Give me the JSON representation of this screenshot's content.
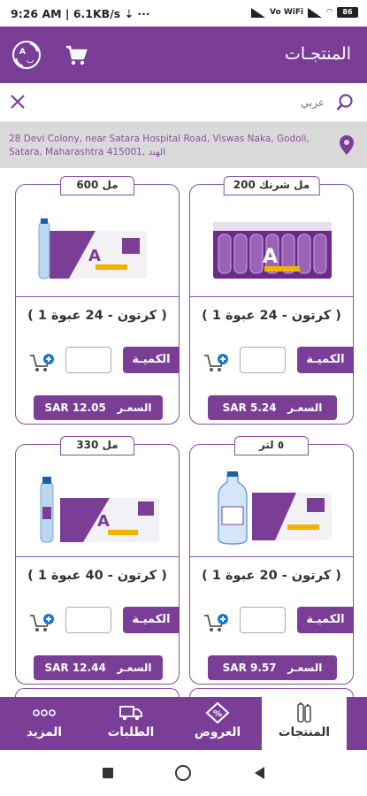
{
  "status_bar": {
    "time": "9:26 AM",
    "speed": "6.1KB/s",
    "network": "Vo WiFi",
    "battery": "86"
  },
  "app_bar": {
    "title": "المنتجـات",
    "icons": [
      "language-switch-icon",
      "cart-icon"
    ]
  },
  "search": {
    "placeholder": "عربي",
    "icons": [
      "close-icon",
      "search-icon"
    ]
  },
  "location": {
    "address": "28 Devi Colony, near Satara Hospital Road, Viswas Naka, Godoli, Satara, Maharashtra 415001, الهند",
    "icon": "location-pin-icon"
  },
  "colors": {
    "brand": "#7a3e96",
    "brand_border": "#8a4fa3"
  },
  "products": [
    {
      "size": "200 مل شرنك",
      "pack": "( 1 كرتون - 24 عبوة )",
      "qty_label": "الكميـة",
      "price_label": "السعـر",
      "price": "SAR 5.24"
    },
    {
      "size": "600 مل",
      "pack": "( 1 كرتون - 24 عبوة )",
      "qty_label": "الكميـة",
      "price_label": "السعـر",
      "price": "SAR 12.05"
    },
    {
      "size": "٥ لتر",
      "pack": "( 1 كرتون - 20 عبوة )",
      "qty_label": "الكميـة",
      "price_label": "السعـر",
      "price": "SAR 9.57"
    },
    {
      "size": "330 مل",
      "pack": "( 1 كرتون - 40 عبوة )",
      "qty_label": "الكميـة",
      "price_label": "السعـر",
      "price": "SAR 12.44"
    }
  ],
  "bottom_nav": {
    "items": [
      {
        "label": "المنتجات",
        "icon": "products-icon",
        "active": true
      },
      {
        "label": "العروض",
        "icon": "offers-icon",
        "active": false
      },
      {
        "label": "الطلبات",
        "icon": "orders-truck-icon",
        "active": false
      },
      {
        "label": "المزيد",
        "icon": "more-dots-icon",
        "active": false
      }
    ]
  }
}
